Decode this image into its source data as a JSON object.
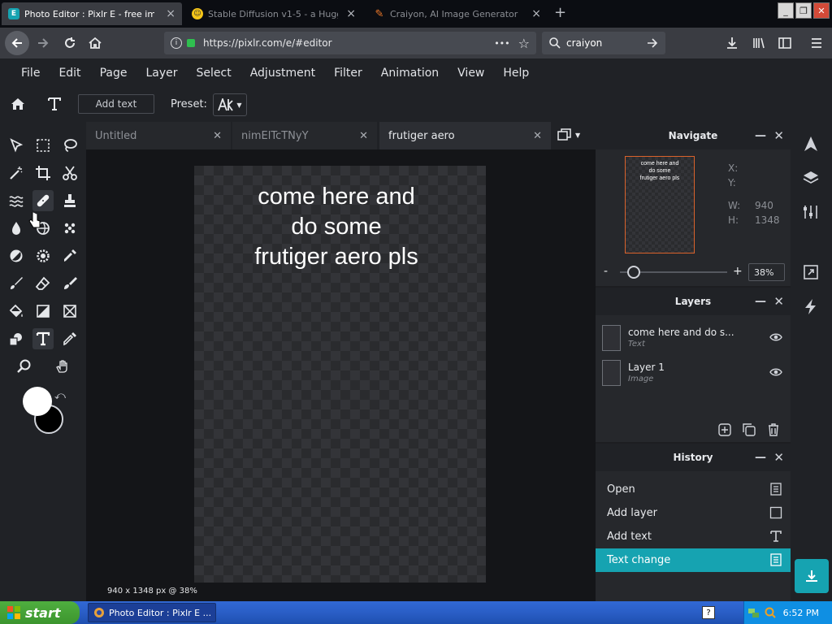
{
  "browser": {
    "tabs": [
      {
        "title": "Photo Editor : Pixlr E - free image ed",
        "icon": "pixlr-icon",
        "active": true
      },
      {
        "title": "Stable Diffusion v1-5 - a Huggin",
        "icon": "huggingface-icon",
        "active": false
      },
      {
        "title": "Craiyon, AI Image Generator",
        "icon": "craiyon-icon",
        "active": false
      }
    ],
    "url": "https://pixlr.com/e/#editor",
    "url_more": "•••",
    "search_value": "craiyon",
    "window_controls": {
      "minimize": "_",
      "restore": "❐",
      "close": "✕"
    }
  },
  "menu": [
    "File",
    "Edit",
    "Page",
    "Layer",
    "Select",
    "Adjustment",
    "Filter",
    "Animation",
    "View",
    "Help"
  ],
  "options_bar": {
    "add_text_label": "Add text",
    "preset_label": "Preset:"
  },
  "colors": {
    "foreground": "#ffffff",
    "background": "#000000",
    "accent": "#16a3b1"
  },
  "doc_tabs": [
    {
      "title": "Untitled",
      "active": false
    },
    {
      "title": "nimElTcTNyY",
      "active": false
    },
    {
      "title": "frutiger aero",
      "active": true
    }
  ],
  "canvas": {
    "text": "come here and\ndo some\nfrutiger aero pls",
    "status": "940 x 1348 px @ 38%"
  },
  "navigate": {
    "title": "Navigate",
    "thumb_text": "come here and\ndo some\nfrutiger aero pls",
    "x_label": "X:",
    "y_label": "Y:",
    "w_label": "W:",
    "w_value": "940",
    "h_label": "H:",
    "h_value": "1348",
    "zoom_minus": "-",
    "zoom_plus": "+",
    "zoom_value": "38%",
    "zoom_fraction": 0.13
  },
  "layers": {
    "title": "Layers",
    "items": [
      {
        "name": "come here and do s...",
        "type": "Text"
      },
      {
        "name": "Layer 1",
        "type": "Image"
      }
    ]
  },
  "history": {
    "title": "History",
    "items": [
      {
        "label": "Open",
        "icon": "document-icon",
        "selected": false
      },
      {
        "label": "Add layer",
        "icon": "square-icon",
        "selected": false
      },
      {
        "label": "Add text",
        "icon": "text-icon",
        "selected": false
      },
      {
        "label": "Text change",
        "icon": "document-icon",
        "selected": true
      }
    ]
  },
  "taskbar": {
    "start_label": "start",
    "task_item": "Photo Editor : Pixlr E ...",
    "clock": "6:52 PM"
  }
}
